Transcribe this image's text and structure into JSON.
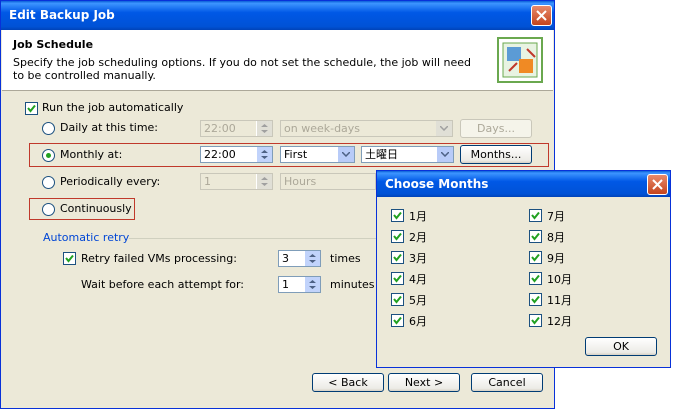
{
  "window": {
    "title": "Edit Backup Job",
    "header_title": "Job Schedule",
    "header_desc": "Specify the job scheduling options. If you do not set the schedule, the job will need to be controlled manually."
  },
  "schedule": {
    "run_auto_label": "Run the job automatically",
    "daily_label": "Daily at this time:",
    "daily_time": "22:00",
    "daily_days": "on week-days",
    "days_button": "Days...",
    "monthly_label": "Monthly at:",
    "monthly_time": "22:00",
    "monthly_week": "First",
    "monthly_day": "土曜日",
    "months_button": "Months...",
    "periodic_label": "Periodically every:",
    "periodic_value": "1",
    "periodic_unit": "Hours",
    "continuous_label": "Continuously"
  },
  "retry": {
    "group_label": "Automatic retry",
    "retry_label": "Retry failed VMs processing:",
    "retry_value": "3",
    "retry_unit": "times",
    "wait_label": "Wait before each attempt for:",
    "wait_value": "1",
    "wait_unit": "minutes"
  },
  "footer": {
    "back": "< Back",
    "next": "Next >",
    "cancel": "Cancel"
  },
  "popup": {
    "title": "Choose Months",
    "months_left": [
      "1月",
      "2月",
      "3月",
      "4月",
      "5月",
      "6月"
    ],
    "months_right": [
      "7月",
      "8月",
      "9月",
      "10月",
      "11月",
      "12月"
    ],
    "ok": "OK"
  },
  "colors": {
    "title_blue": "#0058e6",
    "close_red": "#c4441d",
    "dialog_bg": "#ece9d8",
    "group_label_blue": "#0046d5",
    "highlight_red": "#c0392b"
  }
}
